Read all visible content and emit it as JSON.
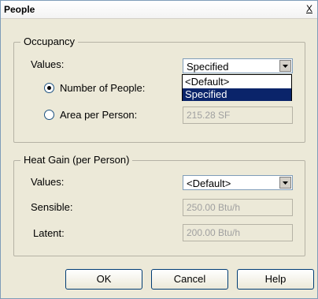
{
  "window": {
    "title": "People",
    "close_label": "X"
  },
  "occupancy": {
    "title": "Occupancy",
    "values_label": "Values:",
    "values_selected": "Specified",
    "dropdown_options": [
      "<Default>",
      "Specified"
    ],
    "number_of_people_label": "Number of People:",
    "area_per_person_label": "Area per Person:",
    "area_per_person_value": "215.28 SF",
    "selected_mode": "Number of People"
  },
  "heat_gain": {
    "title": "Heat Gain (per Person)",
    "values_label": "Values:",
    "values_selected": "<Default>",
    "sensible_label": "Sensible:",
    "sensible_value": "250.00 Btu/h",
    "latent_label": "Latent:",
    "latent_value": "200.00 Btu/h"
  },
  "buttons": {
    "ok": "OK",
    "cancel": "Cancel",
    "help": "Help"
  }
}
